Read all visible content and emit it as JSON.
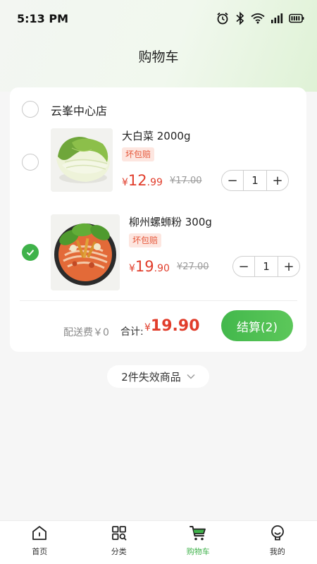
{
  "status_bar": {
    "time": "5:13 PM"
  },
  "header": {
    "title": "购物车"
  },
  "store": {
    "name": "云峯中心店",
    "selected": false
  },
  "items": [
    {
      "name": "大白菜  2000g",
      "tag": "坏包赔",
      "currency": "¥",
      "price_int": "12",
      "price_dec": ".99",
      "original_price": "¥17.00",
      "quantity": "1",
      "checked": false,
      "image": "napa-cabbage"
    },
    {
      "name": "柳州螺蛳粉  300g",
      "tag": "坏包赔",
      "currency": "¥",
      "price_int": "19",
      "price_dec": ".90",
      "original_price": "¥27.00",
      "quantity": "1",
      "checked": true,
      "image": "luosifen-noodles"
    }
  ],
  "summary": {
    "delivery_fee": "配送费￥0",
    "total_label": "合计:",
    "total_currency": "¥",
    "total_amount": "19.90",
    "checkout_label": "结算(2)"
  },
  "invalid_items": {
    "label": "2件失效商品"
  },
  "stepper": {
    "minus": "−",
    "plus": "+"
  },
  "tabbar": [
    {
      "label": "首页",
      "icon": "home-icon",
      "active": false
    },
    {
      "label": "分类",
      "icon": "category-icon",
      "active": false
    },
    {
      "label": "购物车",
      "icon": "cart-icon",
      "active": true
    },
    {
      "label": "我的",
      "icon": "profile-icon",
      "active": false
    }
  ],
  "colors": {
    "accent_green": "#3fb24a",
    "price_red": "#e13d2b",
    "tag_bg": "#fde6e0",
    "tag_text": "#e5573a"
  }
}
